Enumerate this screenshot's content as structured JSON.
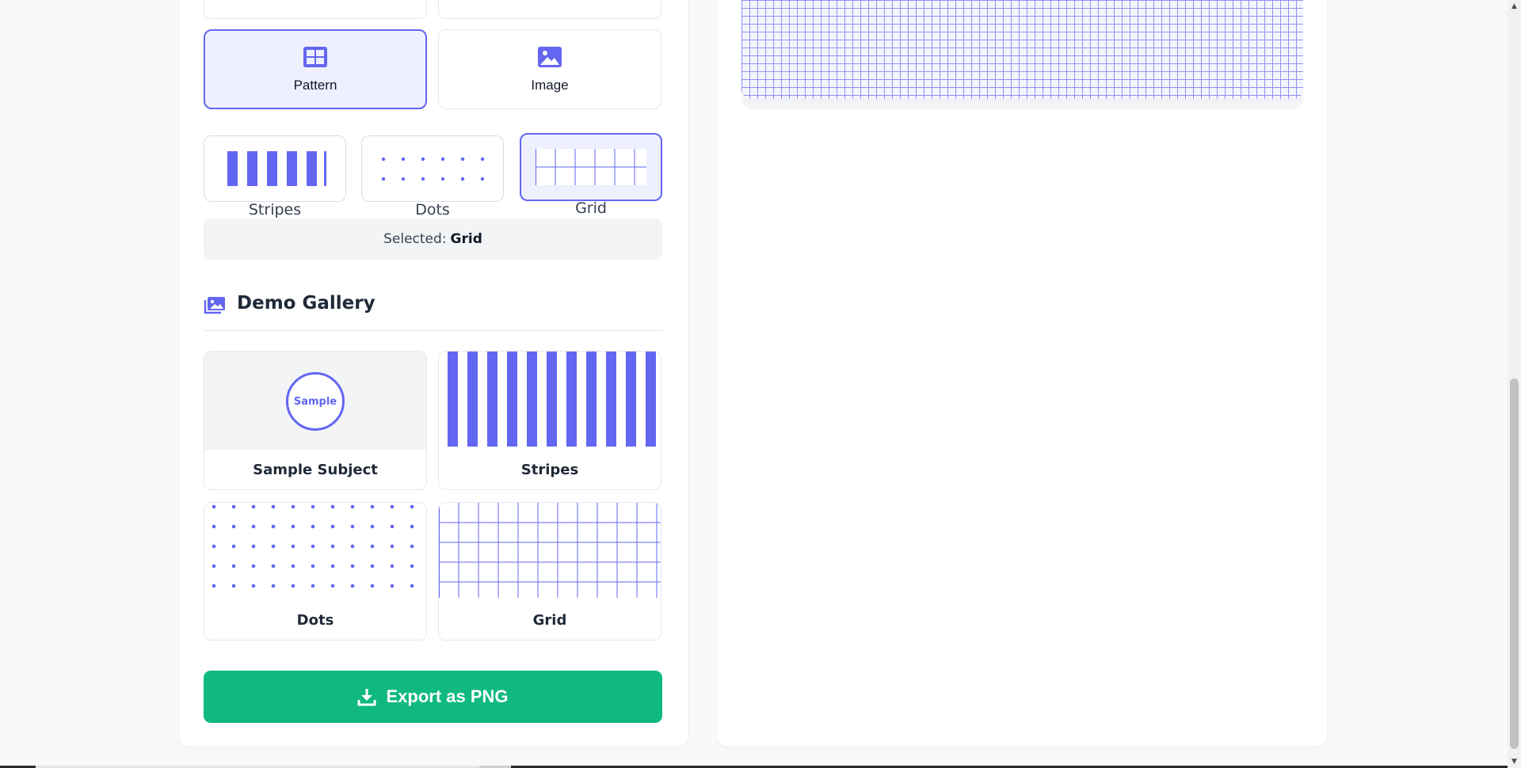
{
  "editor": {
    "type_options": [
      {
        "label": "Pattern",
        "icon": "grid-layout-icon",
        "selected": true
      },
      {
        "label": "Image",
        "icon": "image-icon",
        "selected": false
      }
    ],
    "patterns": [
      {
        "label": "Stripes",
        "selected": false
      },
      {
        "label": "Dots",
        "selected": false
      },
      {
        "label": "Grid",
        "selected": true
      }
    ],
    "selected_prefix": "Selected:",
    "selected_value": "Grid"
  },
  "gallery": {
    "title": "Demo Gallery",
    "icon": "images-icon",
    "items": [
      {
        "caption": "Sample Subject",
        "badge": "Sample"
      },
      {
        "caption": "Stripes"
      },
      {
        "caption": "Dots"
      },
      {
        "caption": "Grid"
      }
    ]
  },
  "export": {
    "label": "Export as PNG",
    "icon": "download-icon"
  },
  "colors": {
    "accent": "#6366f1",
    "export": "#10b981",
    "selected_bg": "#eef0fd"
  }
}
